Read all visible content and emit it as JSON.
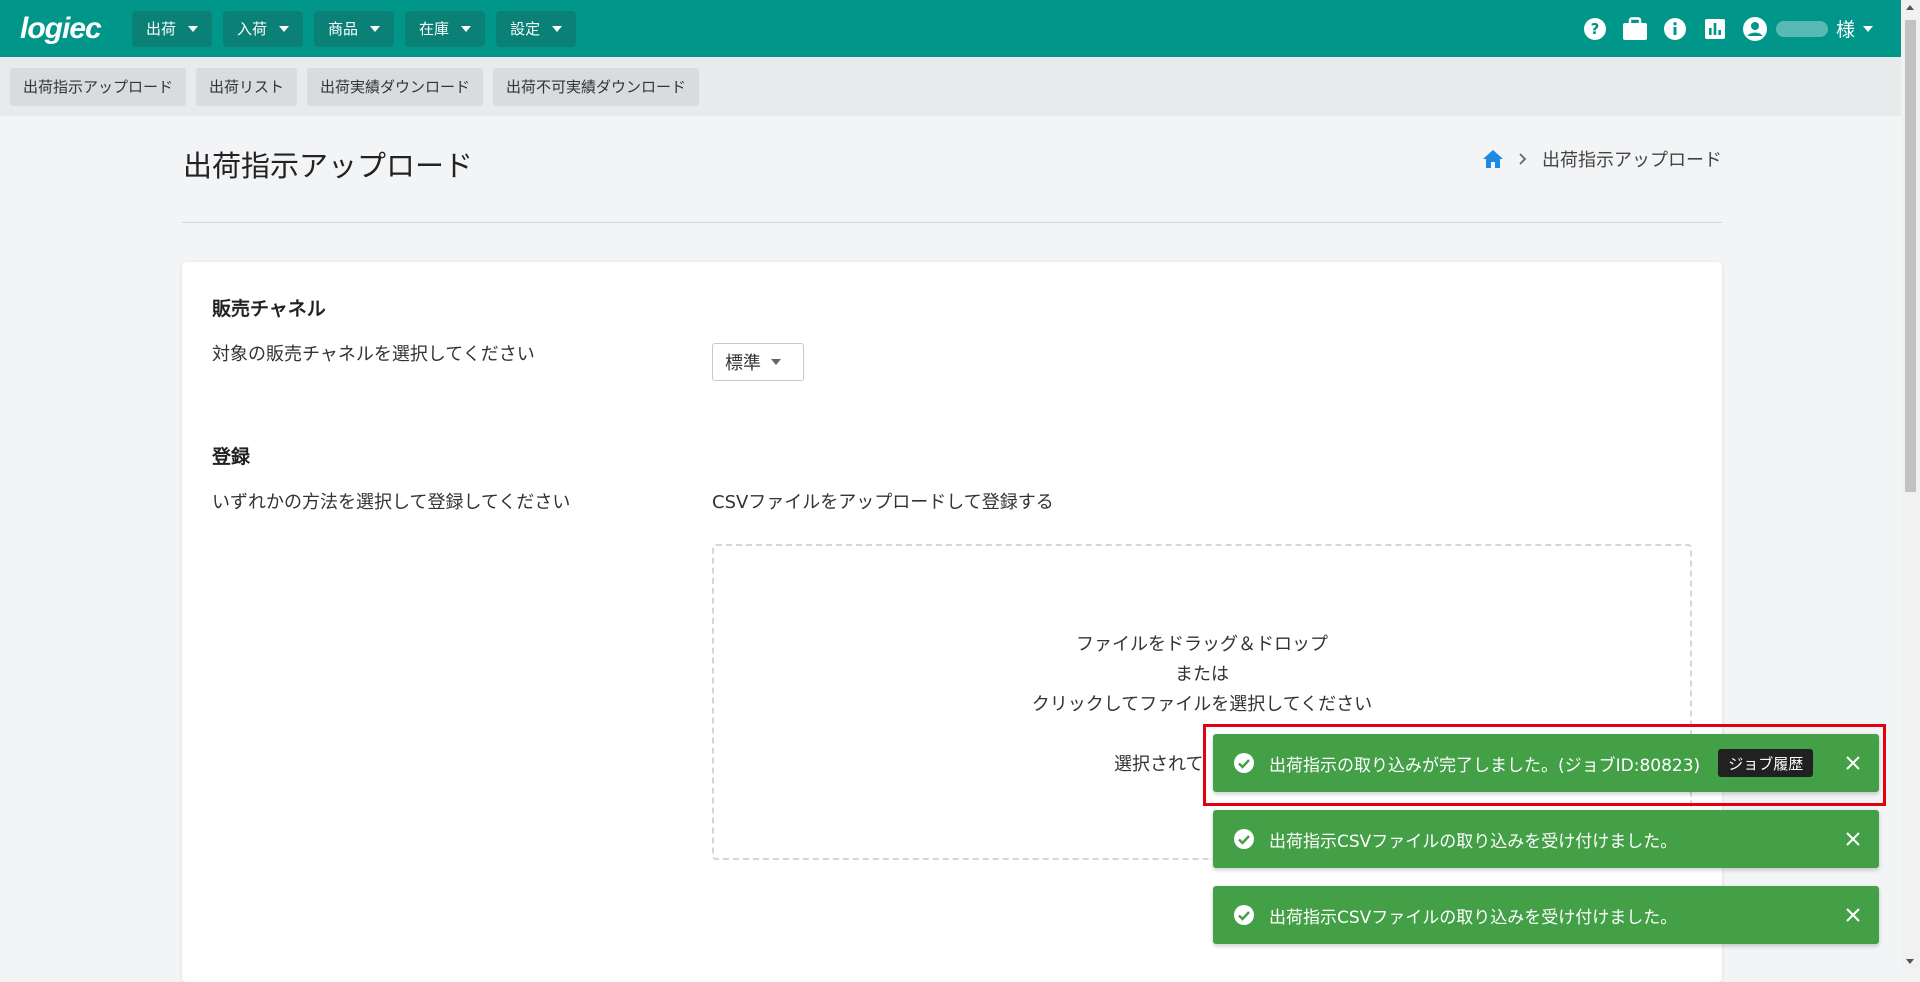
{
  "header": {
    "logo": "logiec",
    "menus": [
      "出荷",
      "入荷",
      "商品",
      "在庫",
      "設定"
    ],
    "icons": [
      "help-icon",
      "briefcase-icon",
      "info-icon",
      "chart-icon",
      "account-icon"
    ],
    "user_suffix": "様"
  },
  "subnav": {
    "items": [
      "出荷指示アップロード",
      "出荷リスト",
      "出荷実績ダウンロード",
      "出荷不可実績ダウンロード"
    ]
  },
  "page": {
    "title": "出荷指示アップロード",
    "breadcrumb_current": "出荷指示アップロード"
  },
  "channel": {
    "title": "販売チャネル",
    "description": "対象の販売チャネルを選択してください",
    "selected": "標準"
  },
  "register": {
    "title": "登録",
    "description": "いずれかの方法を選択して登録してください",
    "csv_label": "CSVファイルをアップロードして登録する",
    "dropzone_line1": "ファイルをドラッグ＆ドロップ",
    "dropzone_line2": "または",
    "dropzone_line3": "クリックしてファイルを選択してください",
    "dropzone_status_partial": "選択されて"
  },
  "toasts": [
    {
      "message": "出荷指示の取り込みが完了しました。(ジョブID:80823)",
      "action": "ジョブ履歴"
    },
    {
      "message": "出荷指示CSVファイルの取り込みを受け付けました。"
    },
    {
      "message": "出荷指示CSVファイルの取り込みを受け付けました。"
    }
  ],
  "colors": {
    "header_bg": "#00968a",
    "toast_bg": "#43a047",
    "highlight": "#e3000f",
    "home_icon": "#1e88e5"
  }
}
